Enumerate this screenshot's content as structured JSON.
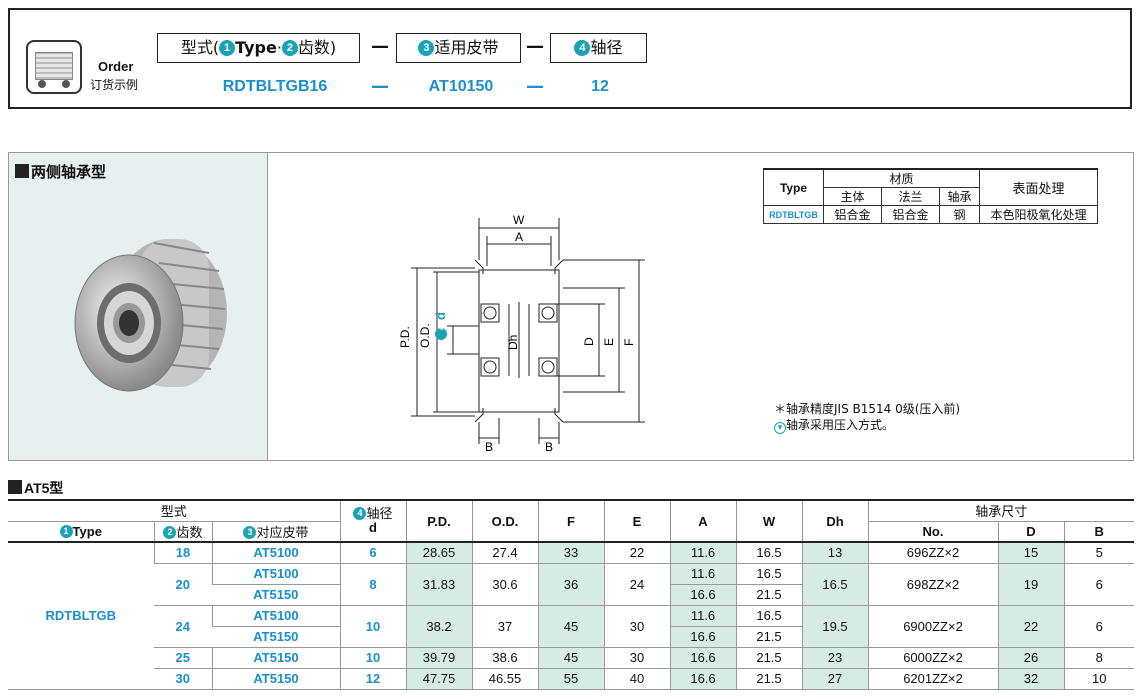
{
  "order": {
    "title": "Order",
    "subtitle": "订货示例",
    "box1_pre": "型式(",
    "box1_n1": "1",
    "box1_type": "Type",
    "box1_dot": "·",
    "box1_n2": "2",
    "box1_teeth": "齿数)",
    "box2_n": "3",
    "box2_label": "适用皮带",
    "box3_n": "4",
    "box3_label": "轴径",
    "sep": "—",
    "val1": "RDTBLTGB16",
    "val2": "AT10150",
    "val3": "12"
  },
  "photo": {
    "label": "两侧轴承型"
  },
  "drawing": {
    "W": "W",
    "A": "A",
    "PD": "P.D.",
    "OD": "O.D.",
    "d_num": "4",
    "d": "d",
    "Dh": "Dh",
    "D": "D",
    "E": "E",
    "F": "F",
    "B1": "B",
    "B2": "B"
  },
  "material": {
    "type_h": "Type",
    "mat_h": "材质",
    "surface_h": "表面处理",
    "body_h": "主体",
    "flange_h": "法兰",
    "bearing_h": "轴承",
    "type": "RDTBLTGB",
    "body": "铝合金",
    "flange": "铝合金",
    "bearing": "钢",
    "surface": "本色阳极氧化处理"
  },
  "notes": {
    "n1": "＊轴承精度JIS B1514 0级(压入前)",
    "n2": "轴承采用压入方式。"
  },
  "section": {
    "label": "AT5型"
  },
  "table": {
    "h_model": "型式",
    "h_type_n": "1",
    "h_type": "Type",
    "h_teeth_n": "2",
    "h_teeth": "齿数",
    "h_belt_n": "3",
    "h_belt": "对应皮带",
    "h_shaft_n": "4",
    "h_shaft": "轴径",
    "h_shaft_d": "d",
    "h_pd": "P.D.",
    "h_od": "O.D.",
    "h_f": "F",
    "h_e": "E",
    "h_a": "A",
    "h_w": "W",
    "h_dh": "Dh",
    "h_bearing": "轴承尺寸",
    "h_no": "No.",
    "h_D": "D",
    "h_B": "B",
    "type_val": "RDTBLTGB",
    "rows": [
      {
        "teeth": "18",
        "belt": "AT5100",
        "d": "6",
        "pd": "28.65",
        "od": "27.4",
        "f": "33",
        "e": "22",
        "a": "11.6",
        "w": "16.5",
        "dh": "13",
        "no": "696ZZ×2",
        "D": "15",
        "B": "5"
      },
      {
        "teeth": "20",
        "belt": "AT5100",
        "d": "8",
        "pd": "31.83",
        "od": "30.6",
        "f": "36",
        "e": "24",
        "a": "11.6",
        "w": "16.5",
        "dh": "16.5",
        "no": "698ZZ×2",
        "D": "19",
        "B": "6"
      },
      {
        "belt": "AT5150",
        "a": "16.6",
        "w": "21.5"
      },
      {
        "teeth": "24",
        "belt": "AT5100",
        "d": "10",
        "pd": "38.2",
        "od": "37",
        "f": "45",
        "e": "30",
        "a": "11.6",
        "w": "16.5",
        "dh": "19.5",
        "no": "6900ZZ×2",
        "D": "22",
        "B": "6"
      },
      {
        "belt": "AT5150",
        "a": "16.6",
        "w": "21.5"
      },
      {
        "teeth": "25",
        "belt": "AT5150",
        "d": "10",
        "pd": "39.79",
        "od": "38.6",
        "f": "45",
        "e": "30",
        "a": "16.6",
        "w": "21.5",
        "dh": "23",
        "no": "6000ZZ×2",
        "D": "26",
        "B": "8"
      },
      {
        "teeth": "30",
        "belt": "AT5150",
        "d": "12",
        "pd": "47.75",
        "od": "46.55",
        "f": "55",
        "e": "40",
        "a": "16.6",
        "w": "21.5",
        "dh": "27",
        "no": "6201ZZ×2",
        "D": "32",
        "B": "10"
      }
    ]
  }
}
